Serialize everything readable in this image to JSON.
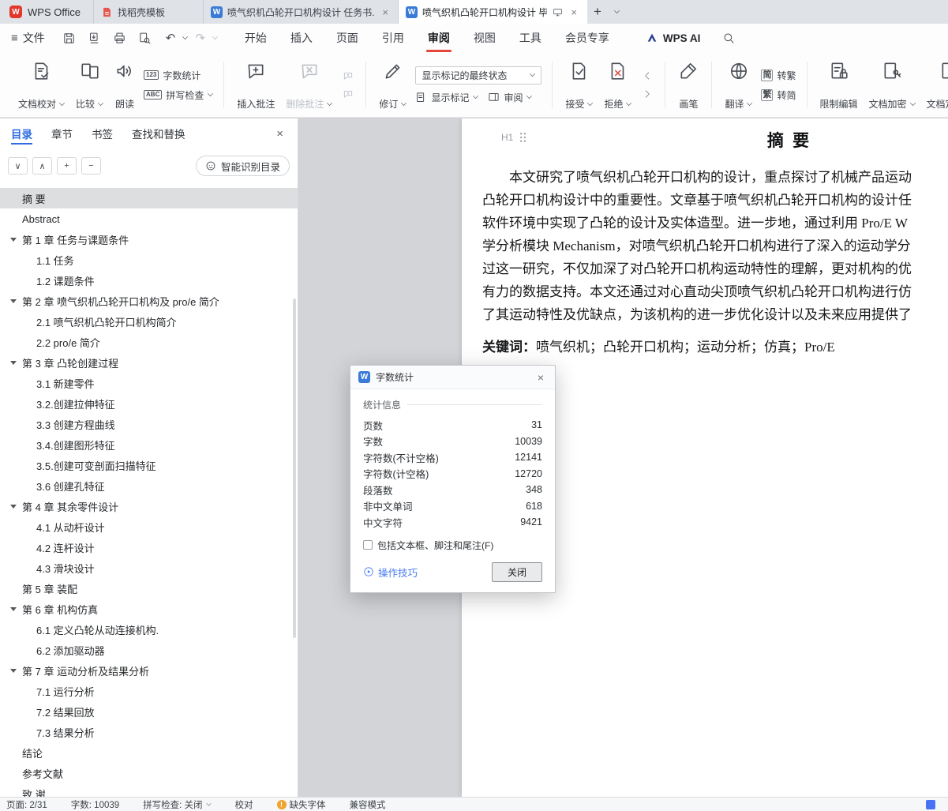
{
  "colors": {
    "brand_red": "#e2382c",
    "menu_underline": "#e2473a",
    "active_blue": "#2f6ce0",
    "writer_blue": "#3a7bd8",
    "link_blue": "#4a7df0",
    "warn_orange": "#f0a32f",
    "reject_red": "#d9534f",
    "view_blue": "#4a72f5"
  },
  "glyphs": {
    "w_badge": "W",
    "close": "×",
    "plus": "+",
    "minus": "−",
    "collapse_all": "∨",
    "expand_all": "∧",
    "hamburger": "≡",
    "undo": "↶",
    "redo": "↷",
    "count_badge": "123",
    "abc_badge": "ABC",
    "jian": "简",
    "fan": "繁",
    "warn": "!"
  },
  "tabbar": {
    "app_name": "WPS Office",
    "tabs": [
      {
        "label": "找稻壳模板"
      },
      {
        "label": "喷气织机凸轮开口机构设计 任务书.do"
      },
      {
        "label": "喷气织机凸轮开口机构设计 毕"
      }
    ]
  },
  "menubar": {
    "file_label": "文件",
    "tabs": [
      {
        "label": "开始"
      },
      {
        "label": "插入"
      },
      {
        "label": "页面"
      },
      {
        "label": "引用"
      },
      {
        "label": "审阅",
        "active": true
      },
      {
        "label": "视图"
      },
      {
        "label": "工具"
      },
      {
        "label": "会员专享"
      }
    ],
    "wps_ai_label": "WPS AI"
  },
  "ribbon": {
    "doc_proof": "文档校对",
    "compare": "比较",
    "read_aloud": "朗读",
    "word_count": "字数统计",
    "spell_check": "拼写检查",
    "insert_comment": "插入批注",
    "delete_comment": "删除批注",
    "track_changes": "修订",
    "markup_state": "显示标记的最终状态",
    "show_markup": "显示标记",
    "review_pane": "审阅",
    "accept": "接受",
    "reject": "拒绝",
    "brush": "画笔",
    "translate": "翻译",
    "s2t": "转繁",
    "t2s": "转简",
    "restrict_edit": "限制编辑",
    "encrypt": "文档加密",
    "finalize": "文档定稿"
  },
  "sidebar": {
    "tabs": [
      {
        "label": "目录",
        "active": true
      },
      {
        "label": "章节"
      },
      {
        "label": "书签"
      },
      {
        "label": "查找和替换"
      }
    ],
    "smart_button": "智能识别目录",
    "toc": [
      {
        "label": "摘 要",
        "level": 0,
        "selected": true
      },
      {
        "label": "Abstract",
        "level": 0
      },
      {
        "label": "第 1 章  任务与课题条件",
        "level": 0,
        "expand": true
      },
      {
        "label": "1.1 任务",
        "level": 1
      },
      {
        "label": "1.2 课题条件",
        "level": 1
      },
      {
        "label": "第 2 章  喷气织机凸轮开口机构及 pro/e 简介",
        "level": 0,
        "expand": true
      },
      {
        "label": "2.1 喷气织机凸轮开口机构简介",
        "level": 1
      },
      {
        "label": "2.2 pro/e 简介",
        "level": 1
      },
      {
        "label": "第 3 章 凸轮创建过程",
        "level": 0,
        "expand": true
      },
      {
        "label": "3.1 新建零件",
        "level": 1
      },
      {
        "label": "3.2.创建拉伸特征",
        "level": 1
      },
      {
        "label": "3.3 创建方程曲线",
        "level": 1
      },
      {
        "label": "3.4.创建图形特征",
        "level": 1
      },
      {
        "label": "3.5.创建可变剖面扫描特征",
        "level": 1
      },
      {
        "label": "3.6 创建孔特征",
        "level": 1
      },
      {
        "label": "第 4 章  其余零件设计",
        "level": 0,
        "expand": true
      },
      {
        "label": "4.1 从动杆设计",
        "level": 1
      },
      {
        "label": "4.2 连杆设计",
        "level": 1
      },
      {
        "label": "4.3 滑块设计",
        "level": 1
      },
      {
        "label": "第 5 章  装配",
        "level": 0
      },
      {
        "label": "第 6 章  机构仿真",
        "level": 0,
        "expand": true
      },
      {
        "label": "6.1 定义凸轮从动连接机构.",
        "level": 1
      },
      {
        "label": "6.2 添加驱动器",
        "level": 1
      },
      {
        "label": "第 7 章  运动分析及结果分析",
        "level": 0,
        "expand": true
      },
      {
        "label": "7.1 运行分析",
        "level": 1
      },
      {
        "label": "7.2  结果回放",
        "level": 1
      },
      {
        "label": "7.3  结果分析",
        "level": 1
      },
      {
        "label": "结论",
        "level": 0
      },
      {
        "label": "参考文献",
        "level": 0
      },
      {
        "label": "致 谢",
        "level": 0
      }
    ]
  },
  "document": {
    "heading_marker": "H1",
    "title": "摘 要",
    "lines": [
      "本文研究了喷气织机凸轮开口机构的设计，重点探讨了机械产品运动",
      "凸轮开口机构设计中的重要性。文章基于喷气织机凸轮开口机构的设计任",
      "软件环境中实现了凸轮的设计及实体造型。进一步地，通过利用 Pro/E W",
      "学分析模块 Mechanism，对喷气织机凸轮开口机构进行了深入的运动学分",
      "过这一研究，不仅加深了对凸轮开口机构运动特性的理解，更对机构的优",
      "有力的数据支持。本文还通过对心直动尖顶喷气织机凸轮开口机构进行仿",
      "了其运动特性及优缺点，为该机构的进一步优化设计以及未来应用提供了"
    ],
    "keywords_label": "关键词：",
    "keywords": "喷气织机；凸轮开口机构；运动分析；仿真；Pro/E"
  },
  "dialog": {
    "title": "字数统计",
    "section_label": "统计信息",
    "stats": [
      {
        "label": "页数",
        "value": "31"
      },
      {
        "label": "字数",
        "value": "10039"
      },
      {
        "label": "字符数(不计空格)",
        "value": "12141"
      },
      {
        "label": "字符数(计空格)",
        "value": "12720"
      },
      {
        "label": "段落数",
        "value": "348"
      },
      {
        "label": "非中文单词",
        "value": "618"
      },
      {
        "label": "中文字符",
        "value": "9421"
      }
    ],
    "checkbox_label": "包括文本框、脚注和尾注(F)",
    "tips_label": "操作技巧",
    "close_label": "关闭"
  },
  "statusbar": {
    "items": [
      {
        "text": "页面: 2/31"
      },
      {
        "text": "字数: 10039"
      },
      {
        "text": "拼写检查: 关闭",
        "chevron": true
      },
      {
        "text": "校对"
      },
      {
        "text": "缺失字体",
        "warn": true
      },
      {
        "text": "兼容模式"
      }
    ]
  }
}
